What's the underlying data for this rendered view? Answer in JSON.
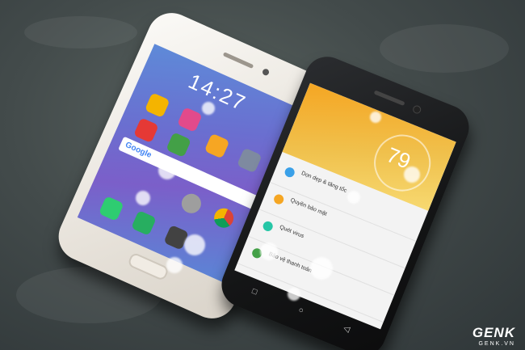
{
  "white_phone": {
    "clock": "14:27",
    "search_brand": "Google",
    "colors": {
      "wallpaper": "#6a6fd0",
      "body": "#f3efe8"
    },
    "icons": [
      "video-app-icon",
      "gallery-app-icon",
      "music-app-icon",
      "security-app-icon",
      "theme-app-icon",
      "settings-app-icon",
      "chrome-app-icon",
      "phone-app-icon",
      "messages-app-icon",
      "camera-app-icon"
    ]
  },
  "black_phone": {
    "score": "79",
    "menu": [
      {
        "label": "Dọn dẹp & tăng tốc",
        "icon": "rocket-icon"
      },
      {
        "label": "Quyền bảo mật",
        "icon": "shield-icon"
      },
      {
        "label": "Quét virus",
        "icon": "scan-icon"
      },
      {
        "label": "Bảo vệ thanh toán",
        "icon": "payment-shield-icon"
      }
    ],
    "colors": {
      "header": "#f5a623",
      "accent": "#3aa0e8"
    }
  },
  "watermark": {
    "logo": "GENK",
    "domain": "GENK.VN"
  }
}
